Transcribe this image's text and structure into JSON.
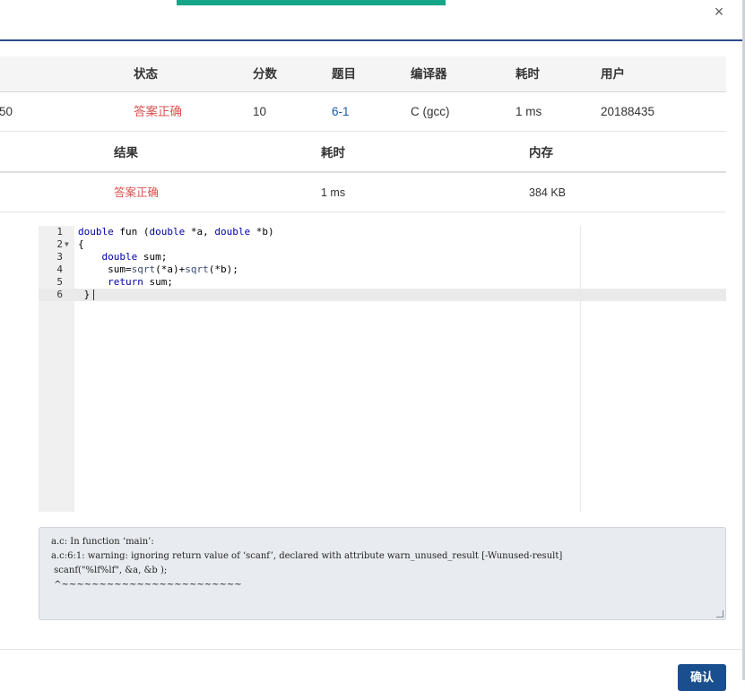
{
  "modal": {
    "close_icon": "×",
    "confirm_label": "确认"
  },
  "submission_table": {
    "headers": [
      "状态",
      "分数",
      "题目",
      "编译器",
      "耗时",
      "用户"
    ],
    "row": {
      "id_fragment": "50",
      "status": "答案正确",
      "score": "10",
      "problem": "6-1",
      "compiler": "C (gcc)",
      "time": "1 ms",
      "user": "20188435"
    }
  },
  "result_table": {
    "headers": [
      "结果",
      "耗时",
      "内存"
    ],
    "row": {
      "result": "答案正确",
      "time": "1 ms",
      "memory": "384 KB"
    }
  },
  "code_editor": {
    "lines": [
      {
        "num": "1",
        "text": "double fun (double *a, double *b)"
      },
      {
        "num": "2",
        "text": "{"
      },
      {
        "num": "3",
        "text": "    double sum;"
      },
      {
        "num": "4",
        "text": "     sum=sqrt(*a)+sqrt(*b);"
      },
      {
        "num": "5",
        "text": "     return sum;"
      },
      {
        "num": "6",
        "text": " }"
      }
    ]
  },
  "compiler_output": {
    "lines": [
      "a.c: In function ‘main’:",
      "a.c:6:1: warning: ignoring return value of ‘scanf’, declared with attribute warn_unused_result [-Wunused-result]",
      " scanf(\"%lf%lf\", &a, &b );",
      " ^~~~~~~~~~~~~~~~~~~~~~~~~"
    ]
  },
  "colors": {
    "accent": "#17a589",
    "header_line": "#2d4b8e",
    "status_ok": "#d9534f",
    "link": "#1a5aa6",
    "button": "#1a4f8f"
  }
}
